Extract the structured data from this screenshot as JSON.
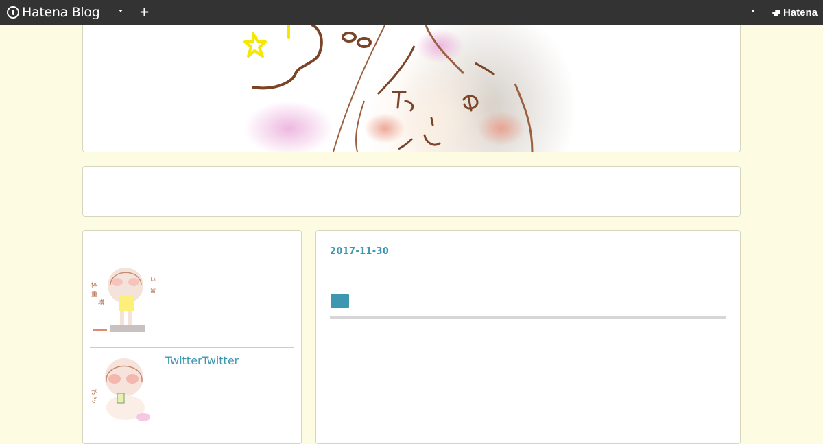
{
  "topbar": {
    "logo_text": "Hatena Blog",
    "brand_text": "Hatena",
    "icons": [
      "hatena-blog-logo-icon",
      "dropdown-caret-icon",
      "plus-icon",
      "hatena-logo-icon"
    ]
  },
  "entry": {
    "date": "2017-11-30"
  },
  "sidebar": {
    "twitter_link": "TwitterTwitter"
  },
  "colors": {
    "background": "#fdfce3",
    "topbar": "#333333",
    "accent": "#3d97b0"
  }
}
